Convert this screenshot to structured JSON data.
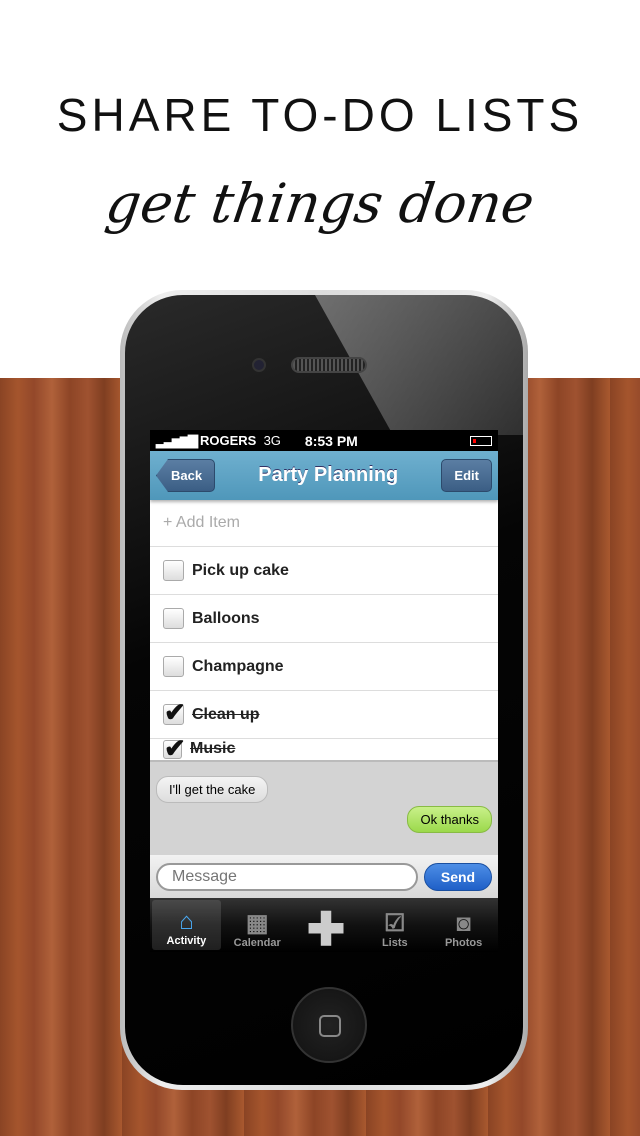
{
  "promo": {
    "headline": "SHARE TO-DO LISTS",
    "tagline": "get things done"
  },
  "status": {
    "carrier": "ROGERS",
    "network": "3G",
    "time": "8:53 PM",
    "battery": "low"
  },
  "nav": {
    "back": "Back",
    "title": "Party Planning",
    "edit": "Edit"
  },
  "list": {
    "add_item": "+ Add Item",
    "items": [
      {
        "label": "Pick up cake",
        "checked": false
      },
      {
        "label": "Balloons",
        "checked": false
      },
      {
        "label": "Champagne",
        "checked": false
      },
      {
        "label": "Clean up",
        "checked": true
      },
      {
        "label": "Music",
        "checked": true
      }
    ]
  },
  "chat": {
    "messages": [
      {
        "text": "I'll get the cake",
        "side": "left"
      },
      {
        "text": "Ok thanks",
        "side": "right"
      }
    ],
    "placeholder": "Message",
    "send": "Send"
  },
  "tabs": [
    {
      "label": "Activity",
      "icon": "home-icon",
      "active": true
    },
    {
      "label": "Calendar",
      "icon": "calendar-icon"
    },
    {
      "label": "",
      "icon": "plus-icon"
    },
    {
      "label": "Lists",
      "icon": "checkbox-icon"
    },
    {
      "label": "Photos",
      "icon": "camera-icon"
    }
  ]
}
